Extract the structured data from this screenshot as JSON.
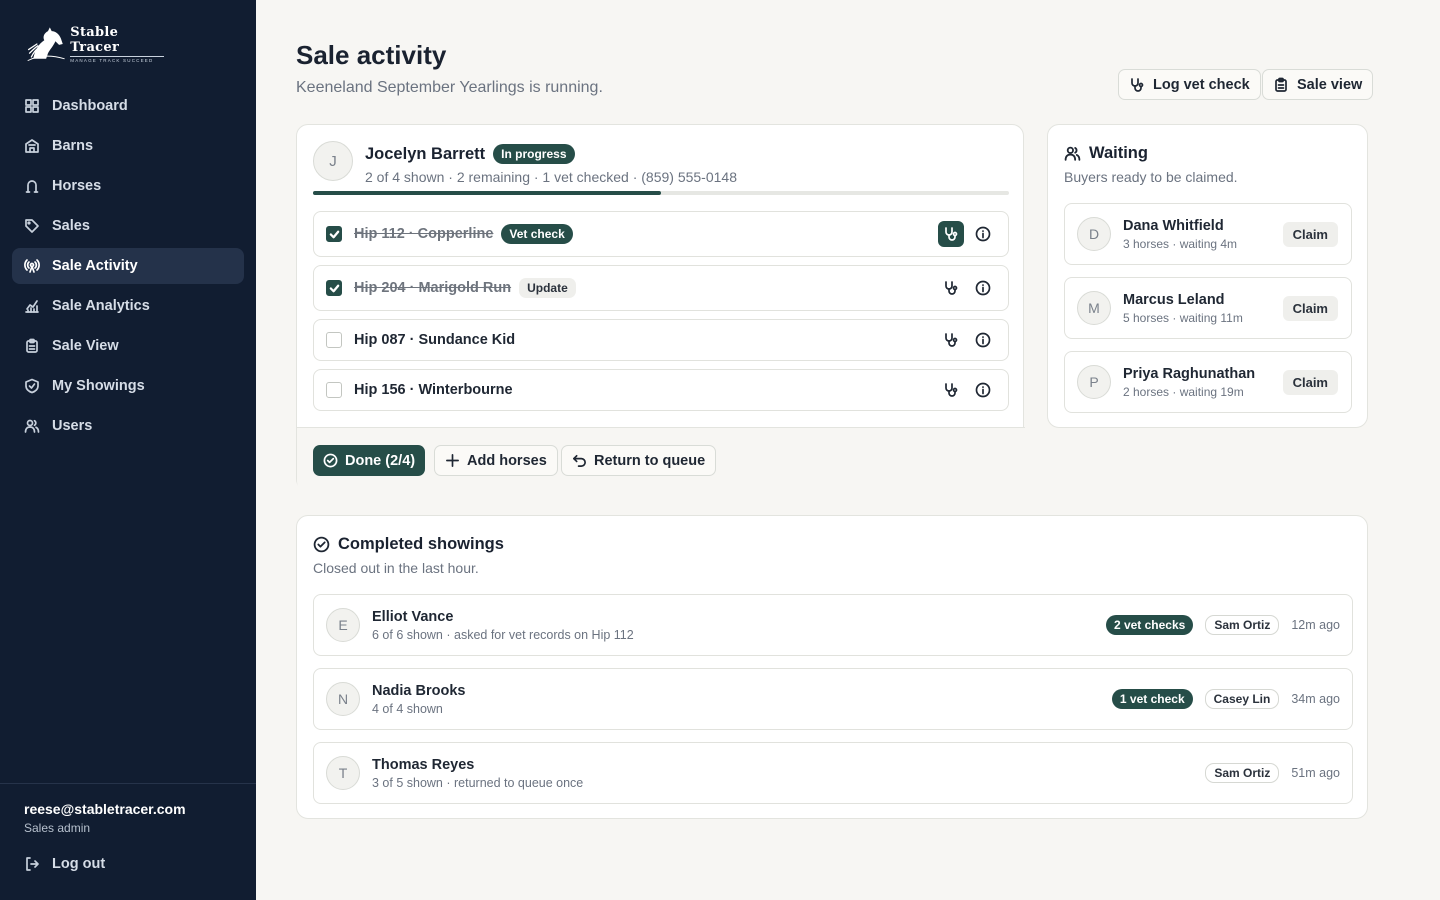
{
  "brand": {
    "name": "Stable Tracer",
    "tagline": "MANAGE TRACK SUCCEED"
  },
  "sidebar": {
    "items": [
      {
        "label": "Dashboard",
        "icon": "dashboard-icon"
      },
      {
        "label": "Barns",
        "icon": "building-icon"
      },
      {
        "label": "Horses",
        "icon": "horseshoe-icon"
      },
      {
        "label": "Sales",
        "icon": "tag-icon"
      },
      {
        "label": "Sale Activity",
        "icon": "broadcast-icon",
        "active": true
      },
      {
        "label": "Sale Analytics",
        "icon": "chart-icon"
      },
      {
        "label": "Sale View",
        "icon": "clipboard-icon"
      },
      {
        "label": "My Showings",
        "icon": "shield-icon"
      },
      {
        "label": "Users",
        "icon": "users-icon"
      }
    ],
    "user": {
      "email": "reese@stabletracer.com",
      "role": "Sales admin"
    },
    "logout_label": "Log out"
  },
  "header": {
    "title": "Sale activity",
    "subtitle": "Keeneland September Yearlings is running.",
    "log_vet_check_label": "Log vet check",
    "sale_view_label": "Sale view"
  },
  "active_showing": {
    "initial": "J",
    "customer": "Jocelyn Barrett",
    "status": "In progress",
    "meta": "2 of 4 shown · 2 remaining · 1 vet checked · (859) 555-0148",
    "progress": 0.5,
    "hips": [
      {
        "label": "Hip 112 · Copperline",
        "checked": true,
        "badge": "Vet check",
        "badge_style": "dark",
        "vet_active": true
      },
      {
        "label": "Hip 204 · Marigold Run",
        "checked": true,
        "badge": "Update",
        "badge_style": "gray",
        "vet_active": false
      },
      {
        "label": "Hip 087 · Sundance Kid",
        "checked": false,
        "badge": "",
        "vet_active": false
      },
      {
        "label": "Hip 156 · Winterbourne",
        "checked": false,
        "badge": "",
        "vet_active": false
      }
    ],
    "done_label": "Done (2/4)",
    "add_horses_label": "Add horses",
    "return_label": "Return to queue"
  },
  "waiting": {
    "title": "Waiting",
    "subtitle": "Buyers ready to be claimed.",
    "claim_label": "Claim",
    "buyers": [
      {
        "initial": "D",
        "name": "Dana Whitfield",
        "meta": "3 horses · waiting 4m"
      },
      {
        "initial": "M",
        "name": "Marcus Leland",
        "meta": "5 horses · waiting 11m"
      },
      {
        "initial": "P",
        "name": "Priya Raghunathan",
        "meta": "2 horses · waiting 19m"
      }
    ]
  },
  "completed": {
    "title": "Completed showings",
    "subtitle": "Closed out in the last hour.",
    "rows": [
      {
        "initial": "E",
        "name": "Elliot Vance",
        "meta": "6 of 6 shown · asked for vet records on Hip 112",
        "vet_badge": "2 vet checks",
        "agent": "Sam Ortiz",
        "time": "12m ago"
      },
      {
        "initial": "N",
        "name": "Nadia Brooks",
        "meta": "4 of 4 shown",
        "vet_badge": "1 vet check",
        "agent": "Casey Lin",
        "time": "34m ago"
      },
      {
        "initial": "T",
        "name": "Thomas Reyes",
        "meta": "3 of 5 shown · returned to queue once",
        "vet_badge": "",
        "agent": "Sam Ortiz",
        "time": "51m ago"
      }
    ]
  },
  "colors": {
    "sidebar_bg": "#111d31",
    "accent": "#264d48",
    "page_bg": "#f7f6f3"
  }
}
